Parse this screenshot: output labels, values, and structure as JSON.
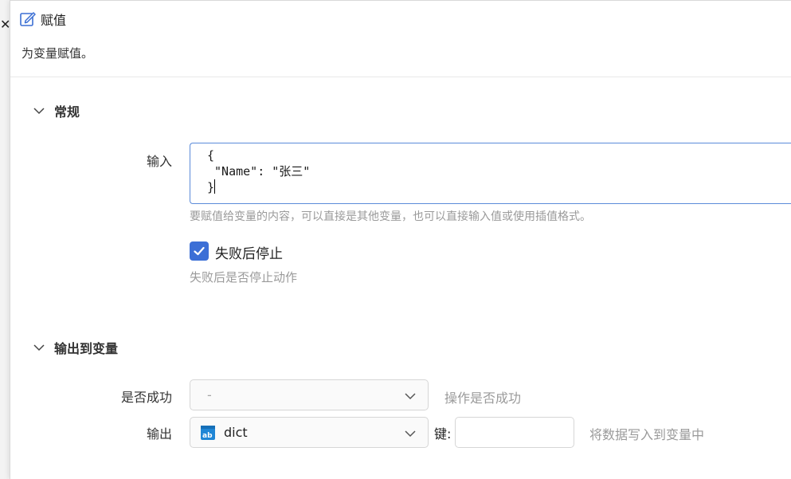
{
  "backdrop": {
    "close_glyph": "✕"
  },
  "dialog": {
    "title_icon": "edit-icon",
    "title": "赋值",
    "subtitle": "为变量赋值。"
  },
  "general": {
    "title": "常规",
    "input": {
      "label": "输入",
      "value_lines": [
        "{",
        " \"Name\": \"张三\"",
        "}"
      ],
      "hint": "要赋值给变量的内容，可以直接是其他变量，也可以直接输入值或使用插值格式。"
    },
    "stop_on_failure": {
      "checked": true,
      "label": "失败后停止",
      "hint": "失败后是否停止动作"
    }
  },
  "output": {
    "title": "输出到变量",
    "success": {
      "label": "是否成功",
      "value": "-",
      "hint": "操作是否成功"
    },
    "result": {
      "label": "输出",
      "type_icon": "text-variable-icon",
      "value": "dict",
      "key_label": "键:",
      "key_value": "",
      "hint": "将数据写入到变量中"
    }
  },
  "colors": {
    "accent": "#3c6fd6",
    "focus_border": "#5b8bd9",
    "hint_text": "#9a9a9a"
  }
}
